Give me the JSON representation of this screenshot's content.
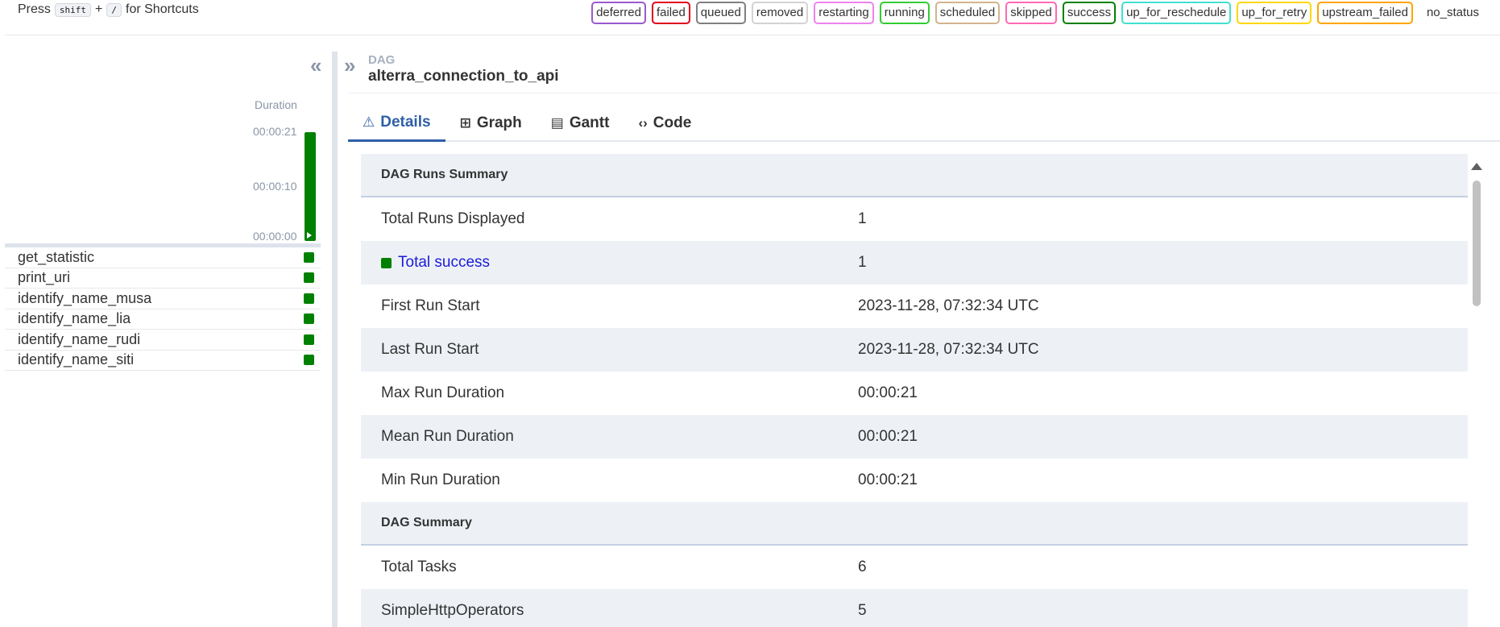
{
  "topbar": {
    "press": "Press",
    "key_shift": "shift",
    "plus": "+",
    "key_slash": "/",
    "for_shortcuts": "for Shortcuts",
    "states": [
      {
        "label": "deferred",
        "color": "#9b59d0"
      },
      {
        "label": "failed",
        "color": "#e0001b"
      },
      {
        "label": "queued",
        "color": "#808080"
      },
      {
        "label": "removed",
        "color": "#d3d3d3"
      },
      {
        "label": "restarting",
        "color": "#ee82ee"
      },
      {
        "label": "running",
        "color": "#32cd32"
      },
      {
        "label": "scheduled",
        "color": "#d2b48c"
      },
      {
        "label": "skipped",
        "color": "#ff69b4"
      },
      {
        "label": "success",
        "color": "#008000"
      },
      {
        "label": "up_for_reschedule",
        "color": "#40e0d0"
      },
      {
        "label": "up_for_retry",
        "color": "#ffd700"
      },
      {
        "label": "upstream_failed",
        "color": "#ffa500"
      }
    ],
    "no_status": "no_status"
  },
  "grid": {
    "collapse_icon": "double-chevron-left-icon",
    "duration_label": "Duration",
    "ticks": [
      "00:00:21",
      "00:00:10",
      "00:00:00"
    ],
    "run": {
      "state": "success",
      "duration_fraction": 1.0
    },
    "tasks": [
      {
        "name": "get_statistic",
        "state": "success"
      },
      {
        "name": "print_uri",
        "state": "success"
      },
      {
        "name": "identify_name_musa",
        "state": "success"
      },
      {
        "name": "identify_name_lia",
        "state": "success"
      },
      {
        "name": "identify_name_rudi",
        "state": "success"
      },
      {
        "name": "identify_name_siti",
        "state": "success"
      }
    ]
  },
  "details": {
    "expand_icon": "double-chevron-right-icon",
    "dag_label": "DAG",
    "dag_id": "alterra_connection_to_api",
    "tabs": [
      {
        "label": "Details",
        "icon": "warning-triangle-icon",
        "glyph": "⚠"
      },
      {
        "label": "Graph",
        "icon": "graph-icon",
        "glyph": "⊞"
      },
      {
        "label": "Gantt",
        "icon": "gantt-icon",
        "glyph": "▤"
      },
      {
        "label": "Code",
        "icon": "code-icon",
        "glyph": "‹›"
      }
    ],
    "dag_runs_summary": "DAG Runs Summary",
    "runs": [
      {
        "key": "Total Runs Displayed",
        "value": "1"
      },
      {
        "key": "Total success",
        "value": "1"
      },
      {
        "key": "First Run Start",
        "value": "2023-11-28, 07:32:34 UTC"
      },
      {
        "key": "Last Run Start",
        "value": "2023-11-28, 07:32:34 UTC"
      },
      {
        "key": "Max Run Duration",
        "value": "00:00:21"
      },
      {
        "key": "Mean Run Duration",
        "value": "00:00:21"
      },
      {
        "key": "Min Run Duration",
        "value": "00:00:21"
      }
    ],
    "dag_summary": "DAG Summary",
    "summary": [
      {
        "key": "Total Tasks",
        "value": "6"
      },
      {
        "key": "SimpleHttpOperators",
        "value": "5"
      }
    ]
  }
}
